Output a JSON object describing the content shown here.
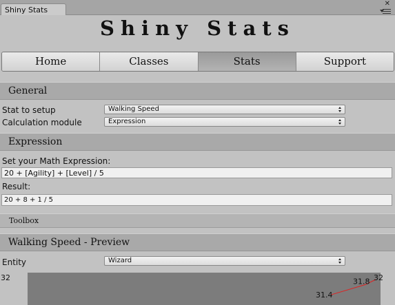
{
  "window": {
    "tab_title": "Shiny Stats"
  },
  "header": {
    "title": "Shiny Stats"
  },
  "nav": {
    "tabs": [
      {
        "label": "Home",
        "active": false
      },
      {
        "label": "Classes",
        "active": false
      },
      {
        "label": "Stats",
        "active": true
      },
      {
        "label": "Support",
        "active": false
      }
    ]
  },
  "general": {
    "title": "General",
    "stat_label": "Stat to setup",
    "stat_value": "Walking Speed",
    "module_label": "Calculation module",
    "module_value": "Expression"
  },
  "expression": {
    "title": "Expression",
    "input_label": "Set your Math Expression:",
    "input_value": "20 + [Agility] + [Level] / 5",
    "result_label": "Result:",
    "result_value": "20 + 8 + 1 / 5"
  },
  "toolbox": {
    "label": "Toolbox"
  },
  "preview": {
    "title": "Walking Speed - Preview",
    "entity_label": "Entity",
    "entity_value": "Wizard"
  },
  "chart_data": {
    "type": "line",
    "ymax_label": "32",
    "points": [
      {
        "label": "31.4",
        "value": 31.4
      },
      {
        "label": "31.8",
        "value": 31.8
      },
      {
        "label": "32",
        "value": 32
      }
    ],
    "line_color": "#e02020",
    "background": "#7c7c7c"
  },
  "colors": {
    "panel": "#c2c2c2",
    "section": "#a9a9a9",
    "active_tab": "#a6a6a6"
  }
}
